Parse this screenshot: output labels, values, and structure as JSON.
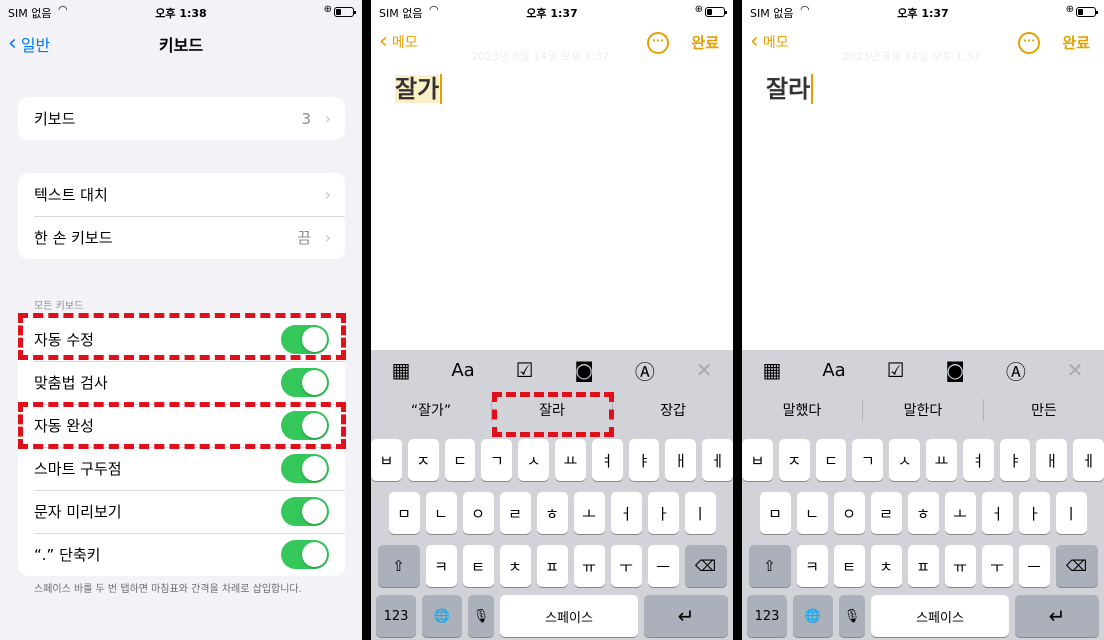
{
  "status": {
    "carrier": "SIM 없음",
    "time1": "오후 1:38",
    "time2": "오후 1:37",
    "time3": "오후 1:37"
  },
  "settings": {
    "back": "일반",
    "title": "키보드",
    "row_keyboards": {
      "label": "키보드",
      "value": "3"
    },
    "row_text_replace": {
      "label": "텍스트 대치"
    },
    "row_one_hand": {
      "label": "한 손 키보드",
      "value": "끔"
    },
    "section": "모든 키보드",
    "toggles": [
      "자동 수정",
      "맞춤법 검사",
      "자동 완성",
      "스마트 구두점",
      "문자 미리보기",
      "“.” 단축키"
    ],
    "footnote": "스페이스 바를 두 번 탭하면 마침표와 간격을 차례로 삽입합니다."
  },
  "notes": {
    "back": "메모",
    "done": "완료",
    "more_icon": "ellipsis-circle-icon",
    "faint_date": "2023년 8월 14일 오후 1:37",
    "text2_hl": "잘가",
    "text3": "잘라"
  },
  "keyboard": {
    "toolbar": [
      "table-icon",
      "Aa",
      "checklist-icon",
      "camera-icon",
      "markup-icon",
      "close-icon"
    ],
    "aa": "Aa",
    "sugg2": [
      "“잘가”",
      "잘라",
      "장갑"
    ],
    "sugg3": [
      "말했다",
      "말한다",
      "만든"
    ],
    "row1": [
      "ㅂ",
      "ㅈ",
      "ㄷ",
      "ㄱ",
      "ㅅ",
      "ㅛ",
      "ㅕ",
      "ㅑ",
      "ㅐ",
      "ㅔ"
    ],
    "row2": [
      "ㅁ",
      "ㄴ",
      "ㅇ",
      "ㄹ",
      "ㅎ",
      "ㅗ",
      "ㅓ",
      "ㅏ",
      "ㅣ"
    ],
    "row3": [
      "ㅋ",
      "ㅌ",
      "ㅊ",
      "ㅍ",
      "ㅠ",
      "ㅜ",
      "ㅡ"
    ],
    "num": "123",
    "space": "스페이스"
  },
  "colors": {
    "accent": "#e5a000",
    "toggle_on": "#34c759",
    "annotation": "#e0101a",
    "link": "#007aff"
  }
}
